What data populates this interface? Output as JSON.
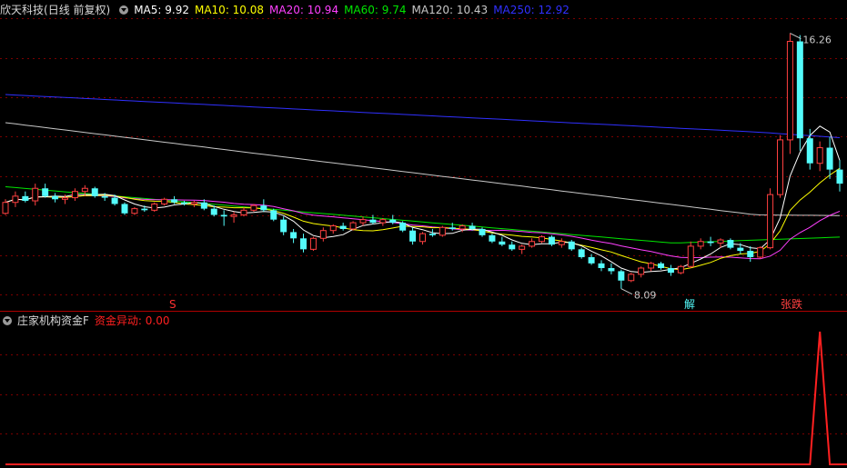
{
  "main_header": {
    "stock_name": "欣天科技",
    "period": "(日线 前复权)",
    "ma5": "MA5: 9.92",
    "ma10": "MA10: 10.08",
    "ma20": "MA20: 10.94",
    "ma60": "MA60: 9.74",
    "ma120": "MA120: 10.43",
    "ma250": "MA250: 12.92"
  },
  "sub_header": {
    "indicator_name": "庄家机构资金F",
    "value_label": "资金异动: 0.00"
  },
  "annotations": {
    "high_price": "16.26",
    "low_price": "8.09",
    "signal_s": "S",
    "signal_jie": "解",
    "signal_zhangdie": "张跌"
  },
  "colors": {
    "up": "#ff4040",
    "down": "#54fcfc",
    "ma5": "#ffffff",
    "ma10": "#ffff00",
    "ma20": "#ff40ff",
    "ma60": "#00e600",
    "ma120": "#c8c8c8",
    "ma250": "#3030ff",
    "fund": "#ff2020",
    "grid": "#7a0000"
  },
  "chart_data": [
    {
      "type": "candlestick",
      "title": "欣天科技 (日线 前复权)",
      "y_range": [
        7.5,
        16.8
      ],
      "x": [
        1,
        2,
        3,
        4,
        5,
        6,
        7,
        8,
        9,
        10,
        11,
        12,
        13,
        14,
        15,
        16,
        17,
        18,
        19,
        20,
        21,
        22,
        23,
        24,
        25,
        26,
        27,
        28,
        29,
        30,
        31,
        32,
        33,
        34,
        35,
        36,
        37,
        38,
        39,
        40,
        41,
        42,
        43,
        44,
        45,
        46,
        47,
        48,
        49,
        50,
        51,
        52,
        53,
        54,
        55,
        56,
        57,
        58,
        59,
        60,
        61,
        62,
        63,
        64,
        64,
        65,
        66,
        67,
        68,
        69,
        70,
        71,
        72,
        73,
        74,
        75,
        76,
        77,
        78,
        79,
        80,
        81,
        82,
        83,
        84,
        85,
        86,
        87,
        88,
        89,
        90,
        91
      ],
      "ohlc": [
        [
          10.5,
          10.95,
          10.45,
          10.85
        ],
        [
          10.85,
          11.2,
          10.7,
          11.05
        ],
        [
          11.05,
          11.2,
          10.85,
          10.9
        ],
        [
          10.9,
          11.45,
          10.75,
          11.3
        ],
        [
          11.3,
          11.45,
          11.0,
          11.05
        ],
        [
          11.05,
          11.15,
          10.85,
          10.95
        ],
        [
          10.95,
          11.1,
          10.8,
          11.0
        ],
        [
          11.0,
          11.3,
          10.9,
          11.2
        ],
        [
          11.2,
          11.4,
          11.05,
          11.3
        ],
        [
          11.3,
          11.35,
          11.0,
          11.05
        ],
        [
          11.05,
          11.15,
          10.9,
          11.0
        ],
        [
          11.0,
          11.1,
          10.75,
          10.8
        ],
        [
          10.8,
          10.85,
          10.45,
          10.5
        ],
        [
          10.5,
          10.7,
          10.45,
          10.65
        ],
        [
          10.65,
          10.75,
          10.55,
          10.6
        ],
        [
          10.6,
          10.85,
          10.55,
          10.8
        ],
        [
          10.8,
          11.0,
          10.75,
          10.95
        ],
        [
          10.95,
          11.05,
          10.8,
          10.85
        ],
        [
          10.85,
          10.9,
          10.75,
          10.8
        ],
        [
          10.8,
          10.9,
          10.7,
          10.85
        ],
        [
          10.85,
          10.95,
          10.6,
          10.65
        ],
        [
          10.65,
          10.75,
          10.4,
          10.45
        ],
        [
          10.45,
          10.6,
          10.1,
          10.4
        ],
        [
          10.4,
          10.55,
          10.2,
          10.45
        ],
        [
          10.45,
          10.7,
          10.4,
          10.6
        ],
        [
          10.6,
          10.8,
          10.55,
          10.75
        ],
        [
          10.75,
          10.95,
          10.55,
          10.6
        ],
        [
          10.6,
          10.65,
          10.25,
          10.3
        ],
        [
          10.3,
          10.4,
          9.8,
          9.9
        ],
        [
          9.9,
          10.0,
          9.55,
          9.7
        ],
        [
          9.7,
          9.85,
          9.25,
          9.35
        ],
        [
          9.35,
          9.75,
          9.3,
          9.7
        ],
        [
          9.7,
          10.05,
          9.6,
          9.95
        ],
        [
          9.95,
          10.15,
          9.85,
          10.1
        ],
        [
          10.1,
          10.2,
          9.95,
          10.0
        ],
        [
          10.0,
          10.25,
          9.95,
          10.2
        ],
        [
          10.2,
          10.4,
          10.1,
          10.3
        ],
        [
          10.3,
          10.45,
          10.15,
          10.2
        ],
        [
          10.2,
          10.35,
          10.1,
          10.3
        ],
        [
          10.3,
          10.45,
          10.15,
          10.2
        ],
        [
          10.2,
          10.25,
          9.9,
          9.95
        ],
        [
          9.95,
          10.05,
          9.5,
          9.6
        ],
        [
          9.6,
          9.9,
          9.5,
          9.85
        ],
        [
          9.85,
          10.0,
          9.75,
          9.8
        ],
        [
          9.8,
          10.1,
          9.75,
          10.05
        ],
        [
          10.05,
          10.2,
          9.95,
          10.0
        ],
        [
          10.0,
          10.15,
          9.9,
          10.1
        ],
        [
          10.1,
          10.2,
          9.95,
          10.0
        ],
        [
          10.0,
          10.05,
          9.75,
          9.8
        ],
        [
          9.8,
          9.85,
          9.55,
          9.6
        ],
        [
          9.6,
          9.75,
          9.45,
          9.5
        ],
        [
          9.5,
          9.6,
          9.3,
          9.35
        ],
        [
          9.35,
          9.5,
          9.2,
          9.45
        ],
        [
          9.45,
          9.7,
          9.4,
          9.6
        ],
        [
          9.6,
          9.8,
          9.55,
          9.75
        ],
        [
          9.75,
          9.8,
          9.45,
          9.5
        ],
        [
          9.5,
          9.7,
          9.4,
          9.6
        ],
        [
          9.6,
          9.65,
          9.3,
          9.35
        ],
        [
          9.35,
          9.4,
          9.05,
          9.1
        ],
        [
          9.1,
          9.2,
          8.85,
          8.9
        ],
        [
          8.9,
          9.0,
          8.65,
          8.75
        ],
        [
          8.75,
          8.9,
          8.55,
          8.65
        ],
        [
          8.65,
          8.7,
          8.09,
          8.35
        ],
        [
          8.35,
          8.6,
          8.3,
          8.55
        ],
        [
          8.55,
          8.8,
          8.45,
          8.75
        ],
        [
          8.75,
          8.95,
          8.65,
          8.9
        ],
        [
          8.9,
          8.95,
          8.7,
          8.75
        ],
        [
          8.75,
          8.85,
          8.5,
          8.6
        ],
        [
          8.6,
          8.85,
          8.55,
          8.8
        ],
        [
          8.8,
          9.6,
          8.75,
          9.45
        ],
        [
          9.45,
          9.7,
          9.35,
          9.6
        ],
        [
          9.6,
          9.75,
          9.45,
          9.55
        ],
        [
          9.55,
          9.7,
          9.4,
          9.65
        ],
        [
          9.65,
          9.7,
          9.35,
          9.4
        ],
        [
          9.4,
          9.55,
          9.2,
          9.3
        ],
        [
          9.3,
          9.45,
          8.95,
          9.1
        ],
        [
          9.1,
          9.45,
          9.05,
          9.4
        ],
        [
          9.4,
          11.3,
          9.35,
          11.1
        ],
        [
          11.1,
          13.0,
          11.0,
          12.85
        ],
        [
          12.85,
          16.26,
          12.4,
          16.0
        ],
        [
          16.0,
          16.2,
          12.5,
          12.9
        ],
        [
          12.9,
          13.2,
          11.9,
          12.1
        ],
        [
          12.1,
          12.8,
          11.85,
          12.6
        ],
        [
          12.6,
          12.95,
          11.6,
          11.9
        ],
        [
          11.9,
          12.2,
          11.2,
          11.45
        ]
      ]
    },
    {
      "type": "line",
      "title": "庄家机构资金F",
      "series": [
        {
          "name": "资金异动",
          "values": [
            0,
            0,
            0,
            0,
            0,
            0,
            0,
            0,
            0,
            0,
            0,
            0,
            0,
            0,
            0,
            0,
            0,
            0,
            0,
            0,
            0,
            0,
            0,
            0,
            0,
            0,
            0,
            0,
            0,
            0,
            0,
            0,
            0,
            0,
            0,
            0,
            0,
            0,
            0,
            0,
            0,
            0,
            0,
            0,
            0,
            0,
            0,
            0,
            0,
            0,
            0,
            0,
            0,
            0,
            0,
            0,
            0,
            0,
            0,
            0,
            0,
            0,
            0,
            0,
            0,
            0,
            0,
            0,
            0,
            0,
            0,
            0,
            0,
            0,
            0,
            0,
            0,
            0,
            0,
            0,
            0,
            0,
            100,
            0,
            0,
            0,
            0,
            0,
            0,
            0,
            0
          ]
        }
      ],
      "y_range": [
        0,
        100
      ]
    }
  ]
}
